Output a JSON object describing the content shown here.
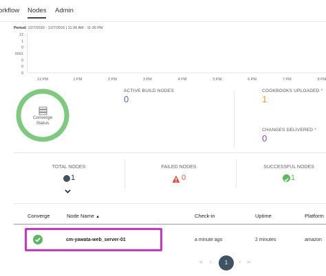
{
  "nav": {
    "tabs": [
      {
        "label": "orkflow"
      },
      {
        "label": "Nodes"
      },
      {
        "label": "Admin"
      }
    ]
  },
  "chart": {
    "period_label": "Period:",
    "period_text": "12/7/2016 - 12/7/2016 | 11:30 AM - 11:30 PM"
  },
  "chart_data": {
    "type": "line",
    "title": "",
    "xlabel": "",
    "ylabel": "",
    "y_tick_labels": [
      "12",
      "1",
      "0",
      "0001",
      "0",
      "0",
      "0"
    ],
    "x_tick_labels": [
      "12 PM",
      "1 PM",
      "2 PM",
      "3 PM",
      "4 PM",
      "5 PM",
      "6 PM",
      "7 PM",
      "8 PM"
    ],
    "series": []
  },
  "converge": {
    "line1": "Converge",
    "line2": "Status",
    "ring_color": "#7dc97d"
  },
  "stats": {
    "active_build_label": "ACTIVE BUILD NODES",
    "active_build_value": "0",
    "cookbooks_label": "COOKBOOKS UPLOADED",
    "cookbooks_asterisk": "*",
    "cookbooks_value": "1",
    "cookbooks_color": "#f39c12",
    "changes_label": "CHANGES DELIVERED",
    "changes_asterisk": "*",
    "changes_value": "0",
    "changes_color": "#8e44ad",
    "active_color": "#4a6fa5"
  },
  "summary": {
    "total_label": "TOTAL NODES",
    "total_value": "1",
    "failed_label": "FAILED NODES",
    "failed_value": "0",
    "failed_color": "#e74c3c",
    "successful_label": "SUCCESSFUL NODES",
    "successful_value": "1",
    "success_color": "#5cb85c"
  },
  "table": {
    "headers": {
      "converge": "Converge",
      "node_name": "Node Name",
      "sort_arrow": "▲",
      "checkin": "Check-in",
      "uptime": "Uptime",
      "platform": "Platform"
    },
    "rows": [
      {
        "node_name": "cm-yawata-web_server-01",
        "checkin": "a minute ago",
        "uptime": "2 minutes",
        "platform": "amazon"
      }
    ]
  },
  "pagination": {
    "first": "«",
    "prev": "‹",
    "current": "1",
    "next": "›",
    "last": "»"
  }
}
